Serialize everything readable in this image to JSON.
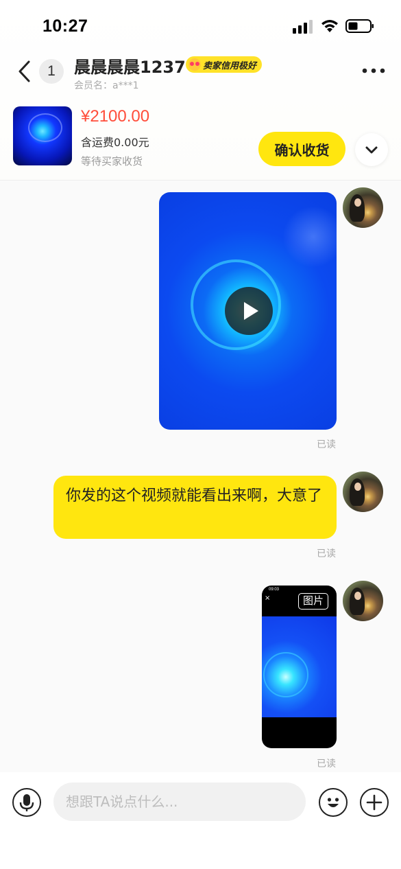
{
  "status_bar": {
    "time": "10:27"
  },
  "header": {
    "unread_count": "1",
    "contact_name": "晨晨晨晨1237",
    "credit_badge": "卖家信用极好",
    "member_label": "会员名：a***1"
  },
  "product": {
    "price": "¥2100.00",
    "shipping": "含运费0.00元",
    "status": "等待买家收货",
    "confirm_label": "确认收货"
  },
  "messages": [
    {
      "type": "video",
      "sender": "self",
      "read_status": "已读"
    },
    {
      "type": "text",
      "sender": "self",
      "text": "你发的这个视频就能看出来啊，大意了",
      "read_status": "已读"
    },
    {
      "type": "image",
      "sender": "self",
      "image_time": "09:03",
      "image_tag": "图片",
      "read_status": "已读"
    }
  ],
  "input_bar": {
    "placeholder": "想跟TA说点什么..."
  },
  "icons": [
    "signal-icon",
    "wifi-icon",
    "battery-icon",
    "back-icon",
    "more-icon",
    "chevron-down-icon",
    "play-icon",
    "microphone-icon",
    "emoji-icon",
    "plus-icon"
  ],
  "colors": {
    "accent_yellow": "#ffe60f",
    "price_red": "#ff4d3a",
    "read_gray": "#a8a8a8"
  }
}
